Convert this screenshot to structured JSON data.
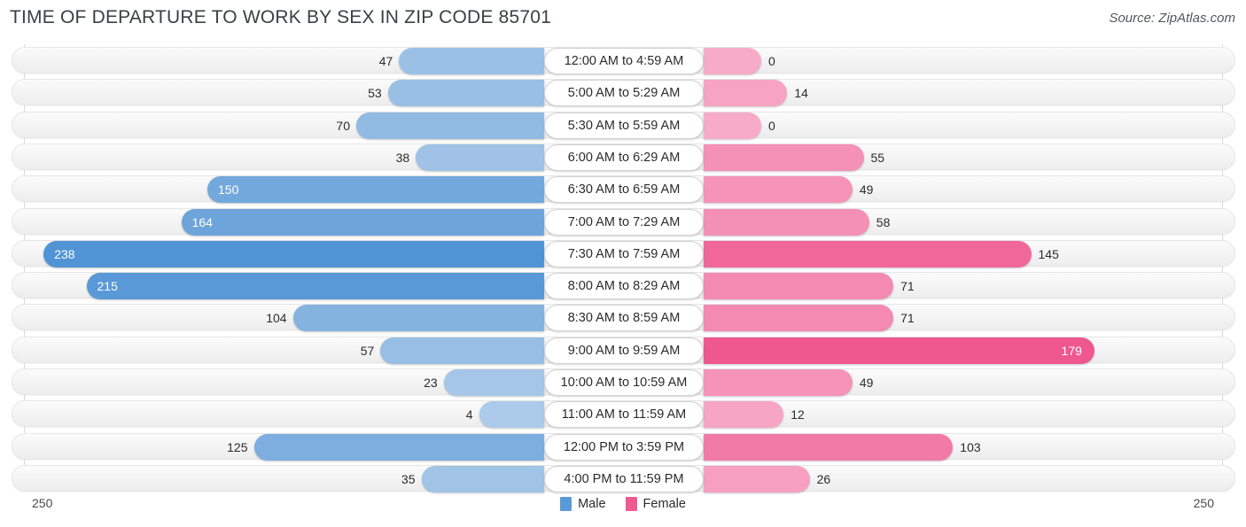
{
  "header": {
    "title": "TIME OF DEPARTURE TO WORK BY SEX IN ZIP CODE 85701",
    "source": "Source: ZipAtlas.com"
  },
  "legend": {
    "items": [
      {
        "label": "Male",
        "color": "#5b9bd5"
      },
      {
        "label": "Female",
        "color": "#ef5a8f"
      }
    ]
  },
  "axis": {
    "left_end": "250",
    "right_end": "250"
  },
  "chart_data": {
    "type": "bar",
    "title": "TIME OF DEPARTURE TO WORK BY SEX IN ZIP CODE 85701",
    "subtitle": "Source: ZipAtlas.com",
    "orientation": "horizontal-diverging",
    "xlabel": "",
    "ylabel": "",
    "xlim": [
      250,
      250
    ],
    "grid": false,
    "legend_position": "bottom-center",
    "categories": [
      "12:00 AM to 4:59 AM",
      "5:00 AM to 5:29 AM",
      "5:30 AM to 5:59 AM",
      "6:00 AM to 6:29 AM",
      "6:30 AM to 6:59 AM",
      "7:00 AM to 7:29 AM",
      "7:30 AM to 7:59 AM",
      "8:00 AM to 8:29 AM",
      "8:30 AM to 8:59 AM",
      "9:00 AM to 9:59 AM",
      "10:00 AM to 10:59 AM",
      "11:00 AM to 11:59 AM",
      "12:00 PM to 3:59 PM",
      "4:00 PM to 11:59 PM"
    ],
    "series": [
      {
        "name": "Male",
        "side": "left",
        "values": [
          47,
          53,
          70,
          38,
          150,
          164,
          238,
          215,
          104,
          57,
          23,
          4,
          125,
          35
        ]
      },
      {
        "name": "Female",
        "side": "right",
        "values": [
          0,
          14,
          0,
          55,
          49,
          58,
          145,
          71,
          71,
          179,
          49,
          12,
          103,
          26
        ]
      }
    ]
  },
  "rows": [
    {
      "category": "12:00 AM to 4:59 AM",
      "male": "47",
      "female": "0"
    },
    {
      "category": "5:00 AM to 5:29 AM",
      "male": "53",
      "female": "14"
    },
    {
      "category": "5:30 AM to 5:59 AM",
      "male": "70",
      "female": "0"
    },
    {
      "category": "6:00 AM to 6:29 AM",
      "male": "38",
      "female": "55"
    },
    {
      "category": "6:30 AM to 6:59 AM",
      "male": "150",
      "female": "49"
    },
    {
      "category": "7:00 AM to 7:29 AM",
      "male": "164",
      "female": "58"
    },
    {
      "category": "7:30 AM to 7:59 AM",
      "male": "238",
      "female": "145"
    },
    {
      "category": "8:00 AM to 8:29 AM",
      "male": "215",
      "female": "71"
    },
    {
      "category": "8:30 AM to 8:59 AM",
      "male": "104",
      "female": "71"
    },
    {
      "category": "9:00 AM to 9:59 AM",
      "male": "57",
      "female": "179"
    },
    {
      "category": "10:00 AM to 10:59 AM",
      "male": "23",
      "female": "49"
    },
    {
      "category": "11:00 AM to 11:59 AM",
      "male": "4",
      "female": "12"
    },
    {
      "category": "12:00 PM to 3:59 PM",
      "male": "125",
      "female": "103"
    },
    {
      "category": "4:00 PM to 11:59 PM",
      "male": "35",
      "female": "26"
    }
  ]
}
